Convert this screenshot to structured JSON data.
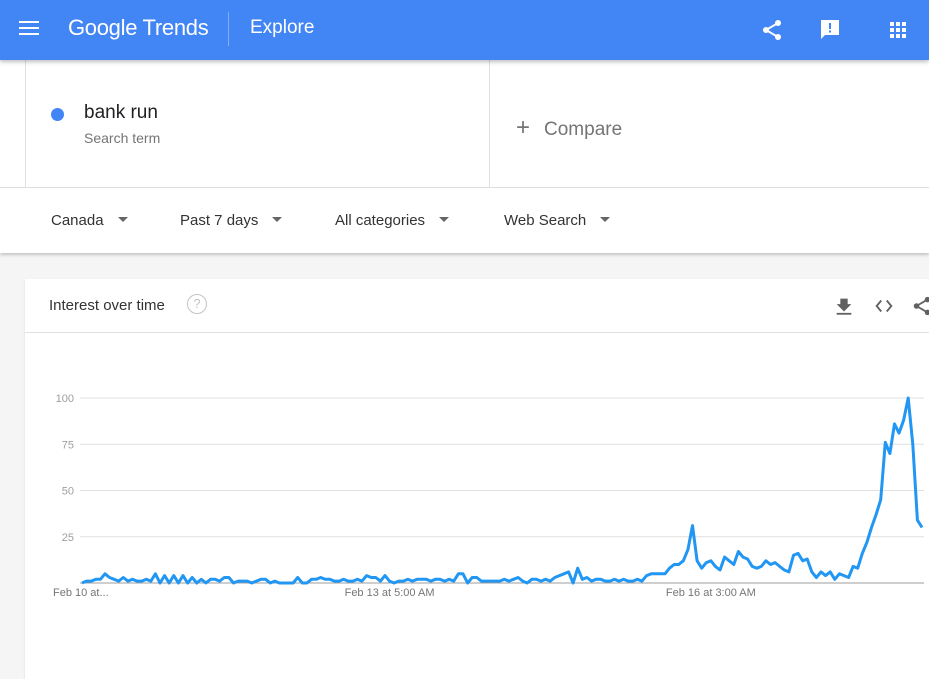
{
  "appbar": {
    "logo": "Google Trends",
    "page": "Explore",
    "icons": [
      "menu-icon",
      "share-icon",
      "feedback-icon",
      "apps-icon"
    ]
  },
  "search": {
    "term": "bank run",
    "term_type": "Search term",
    "term_color": "#4285f4",
    "compare_label": "Compare"
  },
  "filters": {
    "region": "Canada",
    "time": "Past 7 days",
    "category": "All categories",
    "property": "Web Search"
  },
  "card": {
    "title": "Interest over time",
    "help": "?"
  },
  "chart_data": {
    "type": "line",
    "title": "Interest over time",
    "xlabel": "",
    "ylabel": "",
    "ylim": [
      0,
      100
    ],
    "yticks": [
      25,
      50,
      75,
      100
    ],
    "xtick_labels": [
      {
        "index": 0,
        "label": "Feb 10 at..."
      },
      {
        "index": 67,
        "label": "Feb 13 at 5:00 AM"
      },
      {
        "index": 137,
        "label": "Feb 16 at 3:00 AM"
      }
    ],
    "grid": true,
    "series": [
      {
        "name": "bank run",
        "color": "#2196f3",
        "values": [
          0,
          1,
          1,
          2,
          2,
          5,
          3,
          2,
          1,
          3,
          1,
          2,
          1,
          1,
          2,
          1,
          5,
          0,
          4,
          0,
          4,
          0,
          4,
          0,
          3,
          0,
          2,
          0,
          2,
          2,
          1,
          3,
          3,
          0,
          1,
          1,
          1,
          0,
          1,
          2,
          2,
          0,
          1,
          0,
          0,
          0,
          0,
          3,
          0,
          0,
          2,
          2,
          3,
          2,
          2,
          1,
          1,
          2,
          1,
          1,
          2,
          1,
          4,
          3,
          3,
          1,
          4,
          1,
          0,
          1,
          1,
          2,
          1,
          2,
          2,
          2,
          1,
          2,
          2,
          1,
          2,
          1,
          5,
          5,
          0,
          3,
          3,
          1,
          1,
          1,
          1,
          1,
          2,
          1,
          2,
          3,
          1,
          0,
          2,
          2,
          1,
          2,
          1,
          3,
          4,
          5,
          6,
          0,
          8,
          2,
          3,
          1,
          2,
          2,
          1,
          1,
          2,
          1,
          2,
          1,
          1,
          2,
          1,
          4,
          5,
          5,
          5,
          5,
          8,
          10,
          10,
          12,
          18,
          31,
          12,
          8,
          11,
          12,
          9,
          7,
          14,
          12,
          10,
          17,
          14,
          13,
          9,
          8,
          9,
          12,
          10,
          11,
          9,
          7,
          6,
          15,
          16,
          12,
          13,
          6,
          3,
          6,
          4,
          6,
          2,
          5,
          4,
          3,
          9,
          8,
          16,
          22,
          30,
          37,
          45,
          76,
          70,
          86,
          81,
          88,
          100,
          75,
          34,
          30
        ],
        "note": "approximate hourly values read from the line"
      }
    ]
  }
}
